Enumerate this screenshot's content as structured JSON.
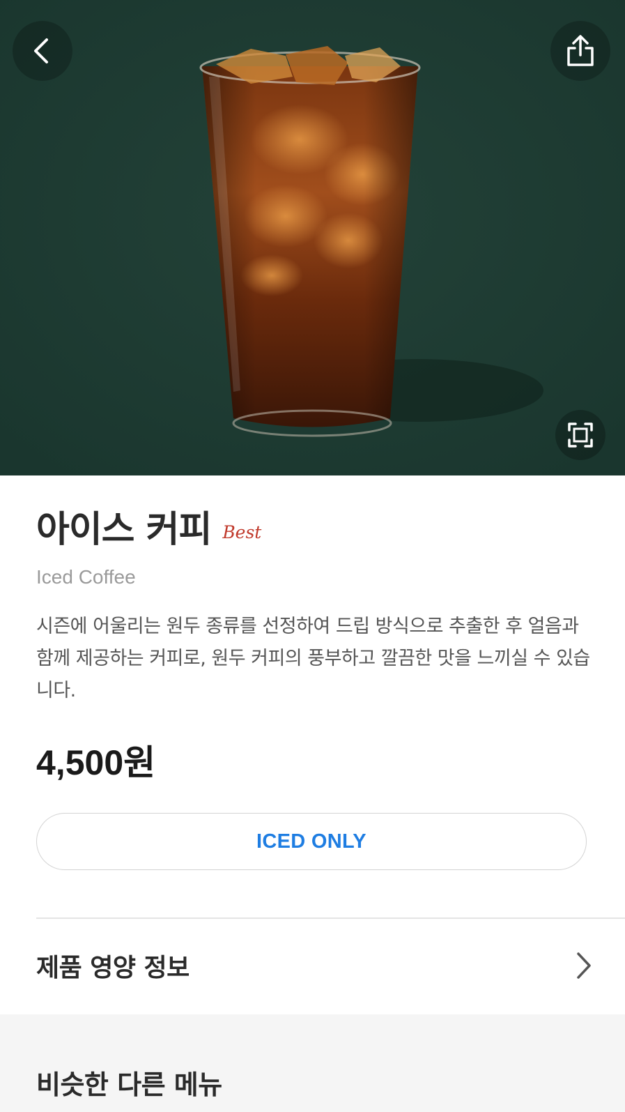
{
  "hero": {
    "image_alt": "Iced coffee in a glass with ice cubes",
    "back_icon": "chevron-left-icon",
    "share_icon": "share-icon",
    "zoom_icon": "expand-icon"
  },
  "product": {
    "name_ko": "아이스 커피",
    "badge": "Best",
    "name_en": "Iced Coffee",
    "description": "시즌에 어울리는 원두 종류를 선정하여 드립 방식으로 추출한 후 얼음과 함께 제공하는 커피로, 원두 커피의 풍부하고 깔끔한 맛을 느끼실 수 있습니다.",
    "price": "4,500원",
    "temperature": "ICED ONLY"
  },
  "nutrition": {
    "label": "제품 영양 정보",
    "icon": "chevron-right-icon"
  },
  "similar": {
    "title": "비슷한 다른 메뉴"
  },
  "colors": {
    "hero_bg": "#1c3a32",
    "badge": "#c0392b",
    "accent_blue": "#1e7de2"
  }
}
